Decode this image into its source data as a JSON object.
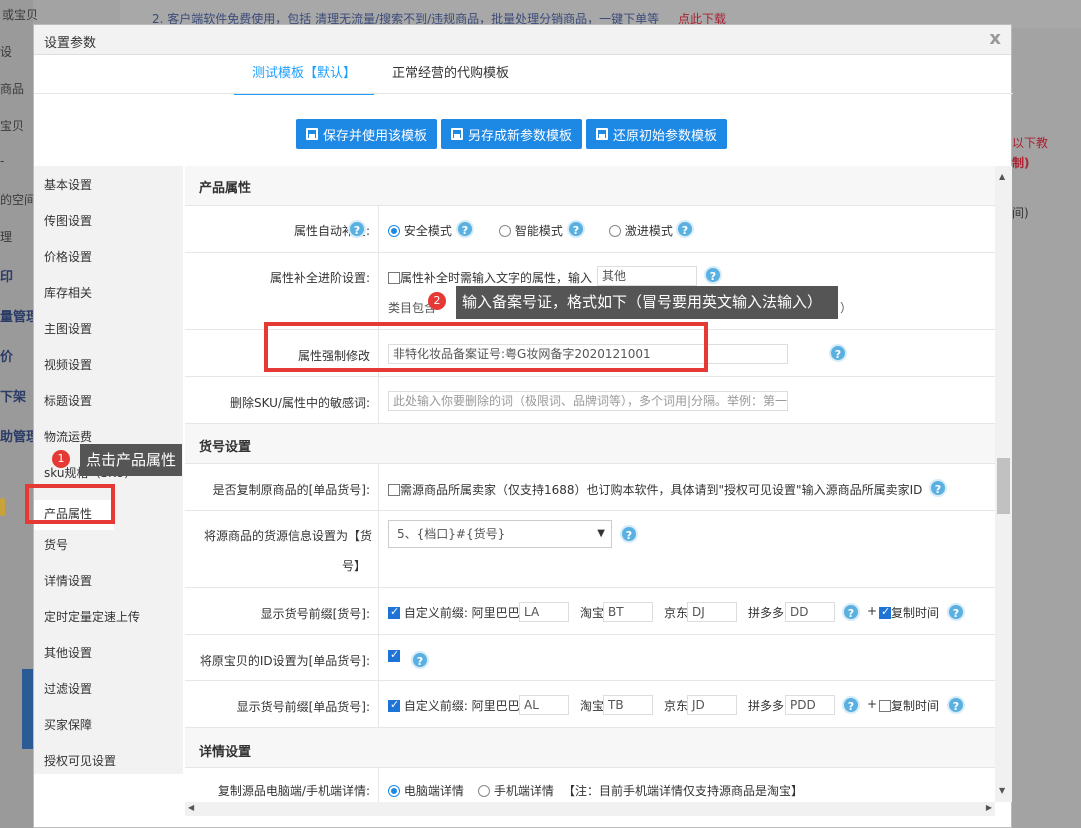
{
  "background": {
    "left_items": [
      "或宝贝",
      "设",
      "商品",
      "宝贝",
      "-",
      "的空间",
      "理",
      "印",
      "量管理",
      "价",
      "下架",
      "助管理"
    ],
    "top_text": "2. 客户端软件免费使用，包括 清理无流量/搜索不到/违规商品，批量处理分销商品，一键下单等",
    "top_link": "点此下载",
    "right_text_1": "以下教",
    "right_text_2": "制)",
    "right_text_3": "间)"
  },
  "dialog": {
    "title": "设置参数",
    "close": "x",
    "tabs": [
      {
        "label": "测试模板【默认】",
        "active": true
      },
      {
        "label": "正常经营的代购模板",
        "active": false
      }
    ],
    "buttons": [
      {
        "label": "保存并使用该模板"
      },
      {
        "label": "另存成新参数模板"
      },
      {
        "label": "还原初始参数模板"
      }
    ]
  },
  "menu": {
    "items": [
      "基本设置",
      "传图设置",
      "价格设置",
      "库存相关",
      "主图设置",
      "视频设置",
      "标题设置",
      "物流运费",
      "sku规格（SKU）",
      "产品属性",
      "货号",
      "详情设置",
      "定时定量定速上传",
      "其他设置",
      "过滤设置",
      "买家保障",
      "授权可见设置"
    ]
  },
  "content": {
    "product_attr": {
      "title": "产品属性",
      "auto_fill_label": "属性自动补全:",
      "modes": [
        "安全模式",
        "智能模式",
        "激进模式"
      ],
      "advanced_label": "属性补全进阶设置:",
      "advanced_text": "属性补全时需输入文字的属性，输入",
      "advanced_value": "其他",
      "advanced_line2": "类目包含",
      "advanced_line2_end": "）",
      "force_label": "属性强制修改",
      "force_value": "非特化妆品备案证号:粤G妆网备字2020121001",
      "sensitive_label": "删除SKU/属性中的敏感词:",
      "sensitive_placeholder": "此处输入你要删除的词（极限词、品牌词等），多个词用|分隔。举例：第一|最"
    },
    "item_no": {
      "title": "货号设置",
      "copy_label": "是否复制原商品的[单品货号]:",
      "copy_text": "需源商品所属卖家（仅支持1688）也订购本软件，具体请到\"授权可见设置\"输入源商品所属卖家ID",
      "source_label_1": "将源商品的货源信息设置为【货",
      "source_label_2": "号】",
      "source_select": "5、{档口}#{货号}",
      "prefix_label": "显示货号前缀[货号]:",
      "prefix_text": "自定义前缀: 阿里巴巴",
      "prefix_values": {
        "ali": "LA",
        "taobao": "BT",
        "jd": "DJ",
        "pdd": "DD"
      },
      "taobao": "淘宝",
      "jd": "京东",
      "pdd": "拼多多",
      "plus": "+",
      "copy_time": "复制时间",
      "orig_id_label": "将原宝贝的ID设置为[单品货号]:",
      "prefix2_label": "显示货号前缀[单品货号]:",
      "prefix2_values": {
        "ali": "AL",
        "taobao": "TB",
        "jd": "JD",
        "pdd": "PDD"
      }
    },
    "detail": {
      "title": "详情设置",
      "copy_label": "复制源品电脑端/手机端详情:",
      "options": [
        "电脑端详情",
        "手机端详情"
      ],
      "note": "【注：目前手机端详情仅支持源商品是淘宝】"
    }
  },
  "annotations": {
    "step1_num": "1",
    "step1_text": "点击产品属性",
    "step2_num": "2",
    "step2_text": "输入备案号证，格式如下（冒号要用英文输入法输入）"
  },
  "help_icon": "?",
  "colors": {
    "accent": "#1e88e5",
    "annotation_red": "#e53935",
    "tooltip_bg": "#555555"
  }
}
